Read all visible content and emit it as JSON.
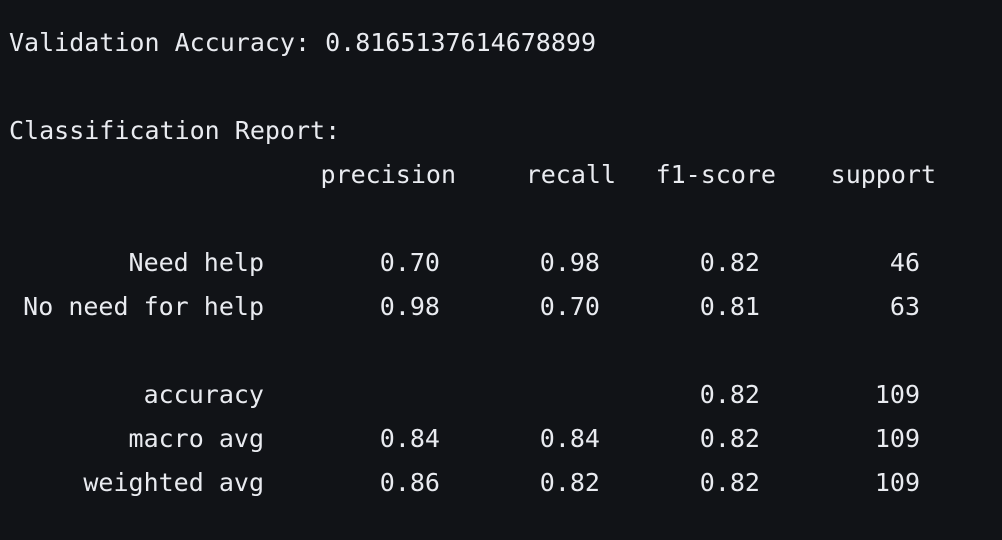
{
  "validation": {
    "label": "Validation Accuracy:",
    "value": "0.8165137614678899"
  },
  "report": {
    "title": "Classification Report:",
    "headers": {
      "precision": "precision",
      "recall": "recall",
      "f1": "f1-score",
      "support": "support"
    },
    "rows": [
      {
        "label": "Need help",
        "precision": "0.70",
        "recall": "0.98",
        "f1": "0.82",
        "support": "46"
      },
      {
        "label": "No need for help",
        "precision": "0.98",
        "recall": "0.70",
        "f1": "0.81",
        "support": "63"
      }
    ],
    "summary": [
      {
        "label": "accuracy",
        "precision": "",
        "recall": "",
        "f1": "0.82",
        "support": "109"
      },
      {
        "label": "macro avg",
        "precision": "0.84",
        "recall": "0.84",
        "f1": "0.82",
        "support": "109"
      },
      {
        "label": "weighted avg",
        "precision": "0.86",
        "recall": "0.82",
        "f1": "0.82",
        "support": "109"
      }
    ]
  }
}
